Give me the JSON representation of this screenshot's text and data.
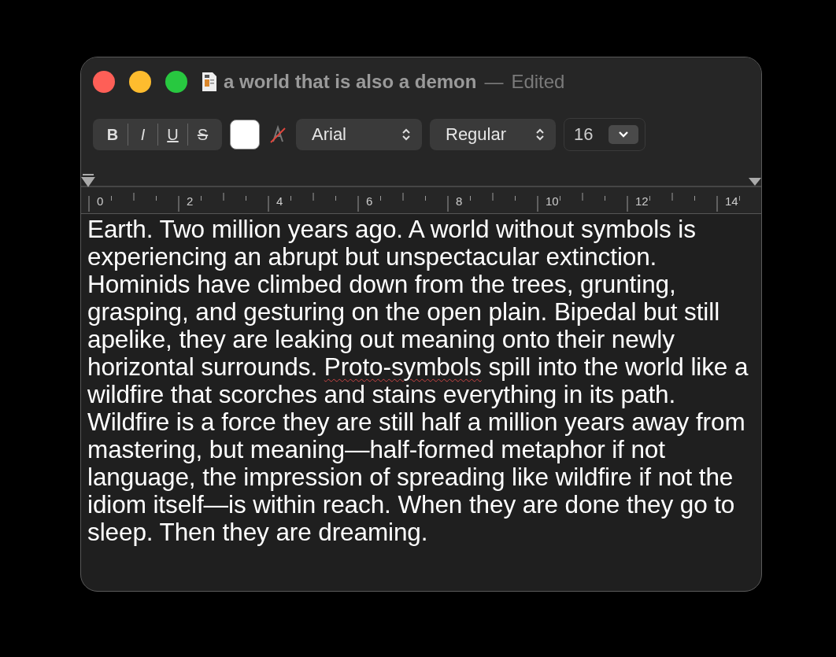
{
  "window": {
    "title": "a world that is also a demon",
    "separator": "—",
    "status": "Edited"
  },
  "toolbar": {
    "style_buttons": [
      {
        "label": "B",
        "kind": "bold"
      },
      {
        "label": "I",
        "kind": "italic"
      },
      {
        "label": "U",
        "kind": "underline"
      },
      {
        "label": "S",
        "kind": "strike"
      }
    ],
    "font_family": "Arial",
    "font_style": "Regular",
    "font_size": "16"
  },
  "ruler": {
    "labels": [
      "0",
      "2",
      "4",
      "6",
      "8",
      "10",
      "12",
      "14"
    ]
  },
  "body": [
    {
      "text": "Earth. Two million years ago. A world without symbols is experiencing an abrupt but unspectacular extinction. Hominids have climbed down from the trees, grunting, grasping, and gesturing on the open plain. Bipedal but still apelike, they are leaking out meaning onto their newly horizontal surrounds. ",
      "misspelled": false
    },
    {
      "text": "Proto-symbols",
      "misspelled": true
    },
    {
      "text": " spill into the world like a wildfire that scorches and stains everything in its path. Wildfire is a force they are still half a million years away from mastering, but meaning—half-formed metaphor if not language, the impression of spreading like wildfire if not the idiom itself—is within reach. When they are done they go to sleep. Then they are dreaming.",
      "misspelled": false
    }
  ]
}
